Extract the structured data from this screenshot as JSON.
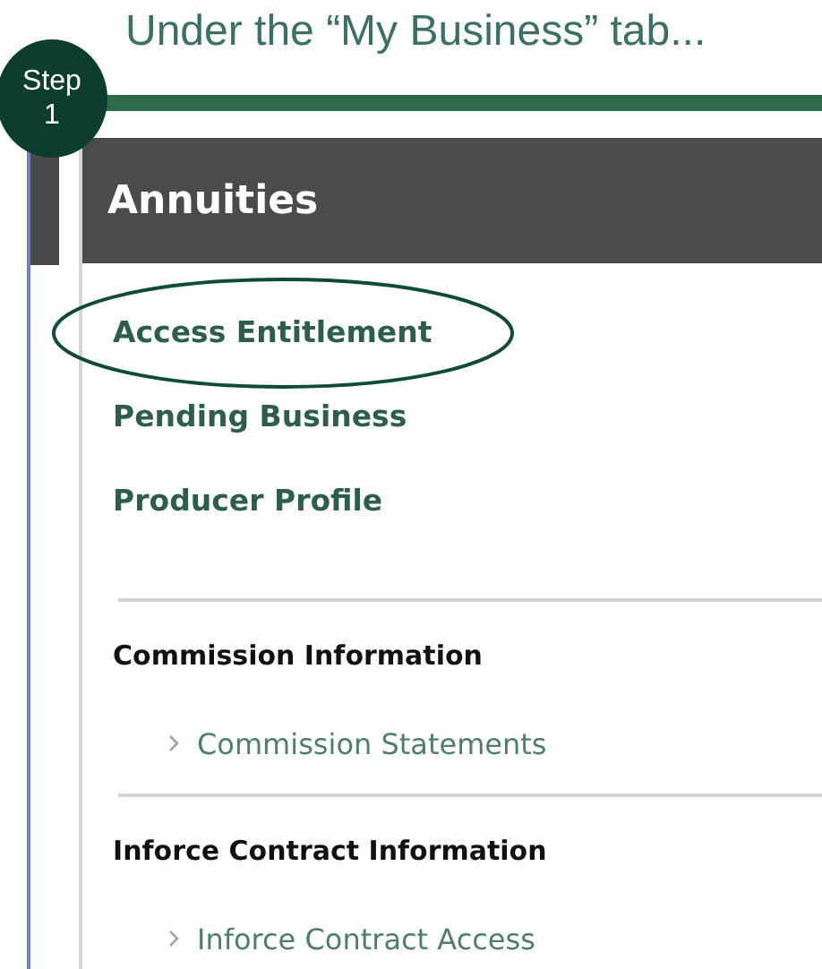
{
  "caption": "Under the “My Business” tab...",
  "step_badge": {
    "label": "Step",
    "number": "1"
  },
  "panel": {
    "title": "Annuities"
  },
  "links": [
    {
      "label": "Access Entitlement",
      "highlighted": true
    },
    {
      "label": "Pending Business",
      "highlighted": false
    },
    {
      "label": "Producer Profile",
      "highlighted": false
    }
  ],
  "sections": [
    {
      "heading": "Commission Information",
      "items": [
        "Commission Statements"
      ]
    },
    {
      "heading": "Inforce Contract Information",
      "items": [
        "Inforce Contract Access"
      ]
    }
  ]
}
